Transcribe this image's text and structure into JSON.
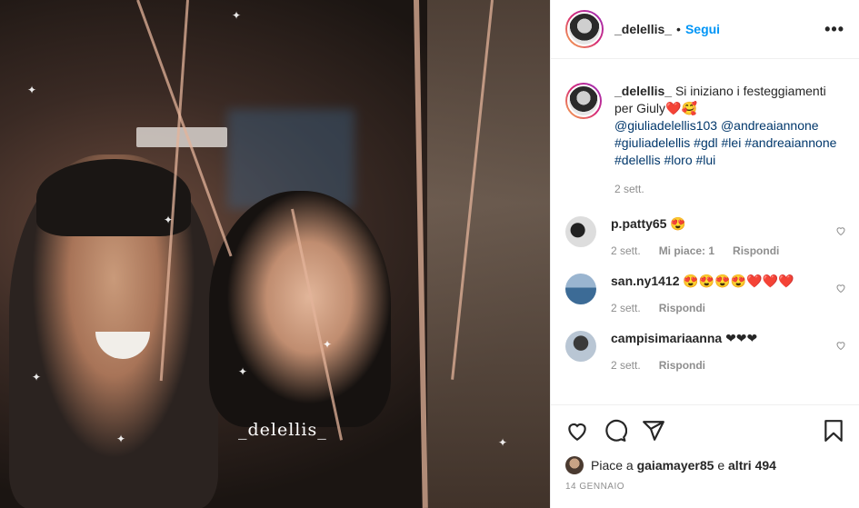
{
  "post": {
    "username": "_delellis_",
    "dot": "•",
    "follow_label": "Segui",
    "more_label": "•••",
    "watermark": "_delellis_"
  },
  "caption": {
    "username": "_delellis_",
    "text": "Si iniziano i festeggiamenti per Giuly",
    "emoji": "❤️🥰",
    "mentions": "@giuliadelellis103 @andreaiannone",
    "hashtags1": "#giuliadelellis #gdl #lei #andreaiannone",
    "hashtags2": "#delellis #loro #lui",
    "time": "2 sett."
  },
  "comments": [
    {
      "username": "p.patty65",
      "text": "😍",
      "time": "2 sett.",
      "likes": "Mi piace: 1",
      "reply": "Rispondi"
    },
    {
      "username": "san.ny1412",
      "text": "😍😍😍😍❤️❤️❤️",
      "time": "2 sett.",
      "reply": "Rispondi"
    },
    {
      "username": "campisimariaanna",
      "text": "❤❤❤",
      "time": "2 sett.",
      "reply": "Rispondi"
    }
  ],
  "likes": {
    "prefix": "Piace a",
    "user": "gaiamayer85",
    "and": "e",
    "others": "altri 494"
  },
  "date": "14 GENNAIO",
  "icons": [
    "heart-icon",
    "comment-icon",
    "share-icon",
    "bookmark-icon"
  ]
}
